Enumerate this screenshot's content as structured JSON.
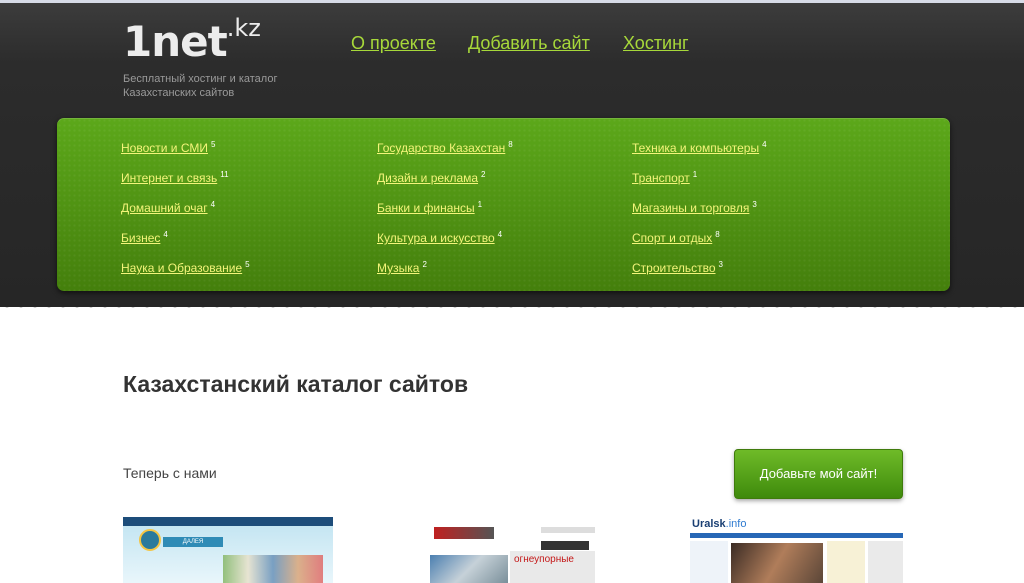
{
  "site": {
    "logo_main": "1net",
    "logo_sup": ".kz",
    "tagline": "Бесплатный хостинг и каталог Казахстанских сайтов"
  },
  "nav": {
    "items": [
      "О проекте",
      "Добавить сайт",
      "Хостинг"
    ],
    "color": "#a7d83a"
  },
  "categories": {
    "col1": [
      {
        "label": "Новости и СМИ",
        "count": "5"
      },
      {
        "label": "Интернет и связь",
        "count": "11"
      },
      {
        "label": "Домашний очаг",
        "count": "4"
      },
      {
        "label": "Бизнес",
        "count": "4"
      },
      {
        "label": "Наука и Образование",
        "count": "5"
      }
    ],
    "col2": [
      {
        "label": "Государство Казахстан",
        "count": "8"
      },
      {
        "label": "Дизайн и реклама",
        "count": "2"
      },
      {
        "label": "Банки и финансы",
        "count": "1"
      },
      {
        "label": "Культура и искусство",
        "count": "4"
      },
      {
        "label": "Музыка",
        "count": "2"
      }
    ],
    "col3": [
      {
        "label": "Техника и компьютеры",
        "count": "4"
      },
      {
        "label": "Транспорт",
        "count": "1"
      },
      {
        "label": "Магазины и торговля",
        "count": "3"
      },
      {
        "label": "Спорт и отдых",
        "count": "8"
      },
      {
        "label": "Строительство",
        "count": "3"
      }
    ],
    "panel_color": "#4e8d12",
    "link_color": "#f4f47a"
  },
  "main": {
    "title": "Казахстанский каталог сайтов",
    "now_with_us": "Теперь с нами",
    "add_button": "Добавьте мой сайт!",
    "button_color": "#5aa51c"
  },
  "thumbnails": [
    {
      "text": "ДАЛЕЯ"
    },
    {
      "text": "огнеупорные"
    },
    {
      "text": "Uralsk",
      "suffix": ".info"
    }
  ]
}
